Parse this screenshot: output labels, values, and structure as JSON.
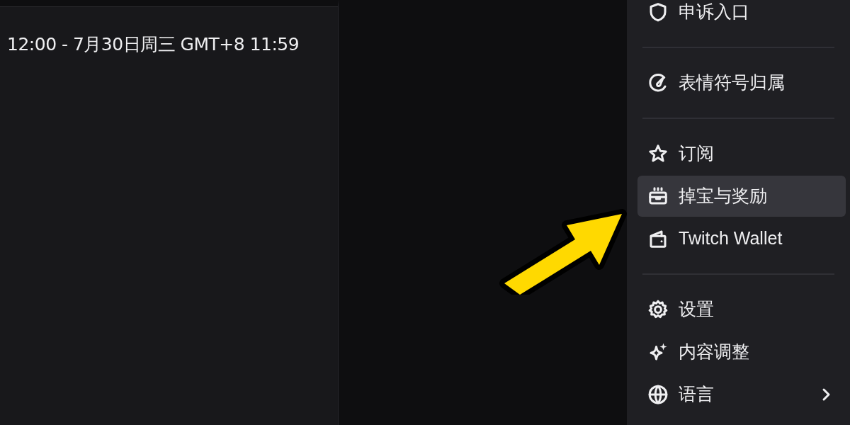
{
  "event": {
    "time_range": "12:00 - 7月30日周三 GMT+8 11:59"
  },
  "menu": {
    "items": [
      {
        "kind": "item",
        "label": "申诉入口",
        "selected": false
      },
      {
        "kind": "divider"
      },
      {
        "kind": "item",
        "label": "表情符号归属",
        "selected": false
      },
      {
        "kind": "divider"
      },
      {
        "kind": "item",
        "label": "订阅",
        "selected": false
      },
      {
        "kind": "item",
        "label": "掉宝与奖励",
        "selected": true
      },
      {
        "kind": "item",
        "label": "Twitch Wallet",
        "selected": false
      },
      {
        "kind": "divider"
      },
      {
        "kind": "item",
        "label": "设置",
        "selected": false
      },
      {
        "kind": "item",
        "label": "内容调整",
        "selected": false
      },
      {
        "kind": "item",
        "label": "语言",
        "selected": false,
        "submenu": true
      }
    ]
  }
}
